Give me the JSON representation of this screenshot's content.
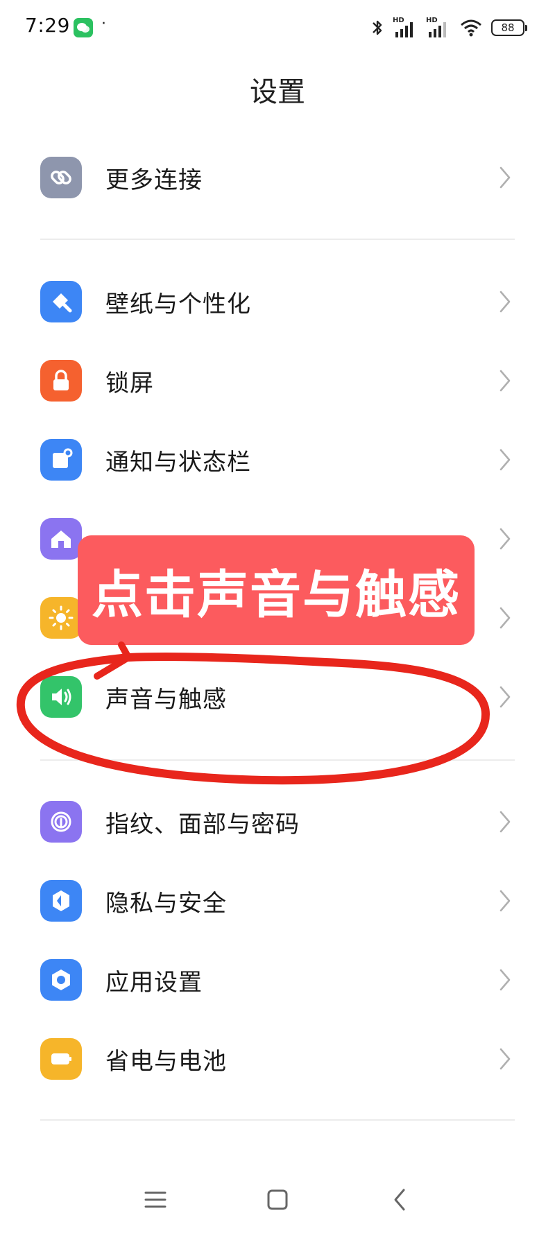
{
  "status_bar": {
    "time": "7:29",
    "network_badge_1": "HD",
    "network_badge_2": "HD",
    "battery": "88"
  },
  "page_title": "设置",
  "items": [
    {
      "label": "更多连接",
      "icon": "link-icon",
      "color": "#8e96ad"
    },
    {
      "label": "壁纸与个性化",
      "icon": "brush-icon",
      "color": "#3d86f5"
    },
    {
      "label": "锁屏",
      "icon": "lock-icon",
      "color": "#f5612f"
    },
    {
      "label": "通知与状态栏",
      "icon": "notification-icon",
      "color": "#3d86f5"
    },
    {
      "label": "",
      "icon": "home-icon",
      "color": "#8b74f0"
    },
    {
      "label": "",
      "icon": "sun-icon",
      "color": "#f6b52a"
    },
    {
      "label": "声音与触感",
      "icon": "speaker-icon",
      "color": "#33c46a"
    },
    {
      "label": "指纹、面部与密码",
      "icon": "fingerprint-icon",
      "color": "#8b74f0"
    },
    {
      "label": "隐私与安全",
      "icon": "shield-icon",
      "color": "#3d86f5"
    },
    {
      "label": "应用设置",
      "icon": "gear-hex-icon",
      "color": "#3d86f5"
    },
    {
      "label": "省电与电池",
      "icon": "battery-icon",
      "color": "#f6b52a"
    }
  ],
  "callout": {
    "text": "点击声音与触感",
    "color": "#fc5b5e"
  },
  "annotation_color": "#e8261c"
}
